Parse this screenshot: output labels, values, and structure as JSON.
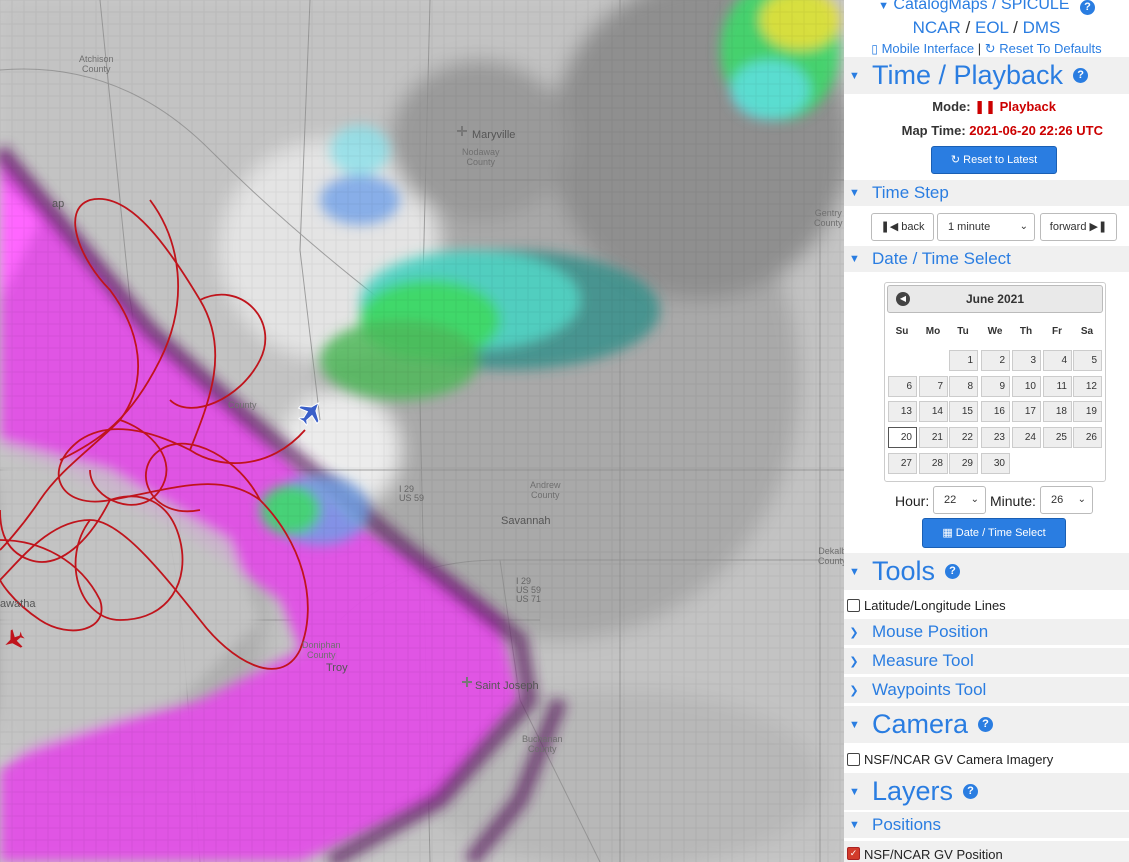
{
  "map": {
    "labels": [
      {
        "id": "atchison",
        "text": "Atchison\nCounty"
      },
      {
        "id": "nodaway",
        "text": "Nodaway\nCounty"
      },
      {
        "id": "andrew",
        "text": "Andrew\nCounty"
      },
      {
        "id": "dekalb",
        "text": "Dekalb\nCounty"
      },
      {
        "id": "gentry",
        "text": "Gentry\nCounty"
      },
      {
        "id": "doniphan",
        "text": "Doniphan\nCounty"
      },
      {
        "id": "buchanan",
        "text": "Buchanan\nCounty"
      },
      {
        "id": "holt",
        "text": "County"
      }
    ],
    "cities": {
      "maryville": "Maryville",
      "savannah": "Savannah",
      "saint_joseph": "Saint Joseph",
      "troy": "Troy",
      "hiawatha": "awatha",
      "tarkio": "ap"
    },
    "shields": {
      "i29_north": "I 29\nUS 59",
      "i29_south": "I 29\nUS 59\nUS 71"
    },
    "colors": {
      "track": "#c0141c",
      "aircraft_active": "#3a5fc8",
      "aircraft_other": "#c0141c",
      "radar_magenta": "#e040e8",
      "radar_green": "#3fd86a",
      "radar_cyan": "#5fe0e8"
    }
  },
  "panel": {
    "links": {
      "catalog": "CatalogMaps / SPICULE",
      "ncar": "NCAR",
      "eol": "EOL",
      "dms": "DMS",
      "mobile": "Mobile Interface",
      "reset_defaults": "Reset To Defaults"
    },
    "time_playback": {
      "title": "Time / Playback",
      "mode_label": "Mode:",
      "mode_value": "Playback",
      "map_time_label": "Map Time:",
      "map_time_value": "2021-06-20 22:26 UTC",
      "reset_latest": "Reset to Latest"
    },
    "time_step": {
      "title": "Time Step",
      "back": "back",
      "step_value": "1 minute",
      "forward": "forward"
    },
    "date_time_select": {
      "title": "Date / Time Select",
      "month_title": "June 2021",
      "dow": [
        "Su",
        "Mo",
        "Tu",
        "We",
        "Th",
        "Fr",
        "Sa"
      ],
      "weeks": [
        [
          "",
          "",
          "1",
          "2",
          "3",
          "4",
          "5"
        ],
        [
          "6",
          "7",
          "8",
          "9",
          "10",
          "11",
          "12"
        ],
        [
          "13",
          "14",
          "15",
          "16",
          "17",
          "18",
          "19"
        ],
        [
          "20",
          "21",
          "22",
          "23",
          "24",
          "25",
          "26"
        ],
        [
          "27",
          "28",
          "29",
          "30",
          "",
          "",
          ""
        ]
      ],
      "selected_day": "20",
      "hour_label": "Hour:",
      "hour_value": "22",
      "minute_label": "Minute:",
      "minute_value": "26",
      "submit": "Date / Time Select"
    },
    "tools": {
      "title": "Tools",
      "latlon": "Latitude/Longitude Lines",
      "mouse_position": "Mouse Position",
      "measure_tool": "Measure Tool",
      "waypoints_tool": "Waypoints Tool"
    },
    "camera": {
      "title": "Camera",
      "gv_camera": "NSF/NCAR GV Camera Imagery"
    },
    "layers": {
      "title": "Layers",
      "positions": "Positions",
      "gv_position": "NSF/NCAR GV Position"
    }
  }
}
